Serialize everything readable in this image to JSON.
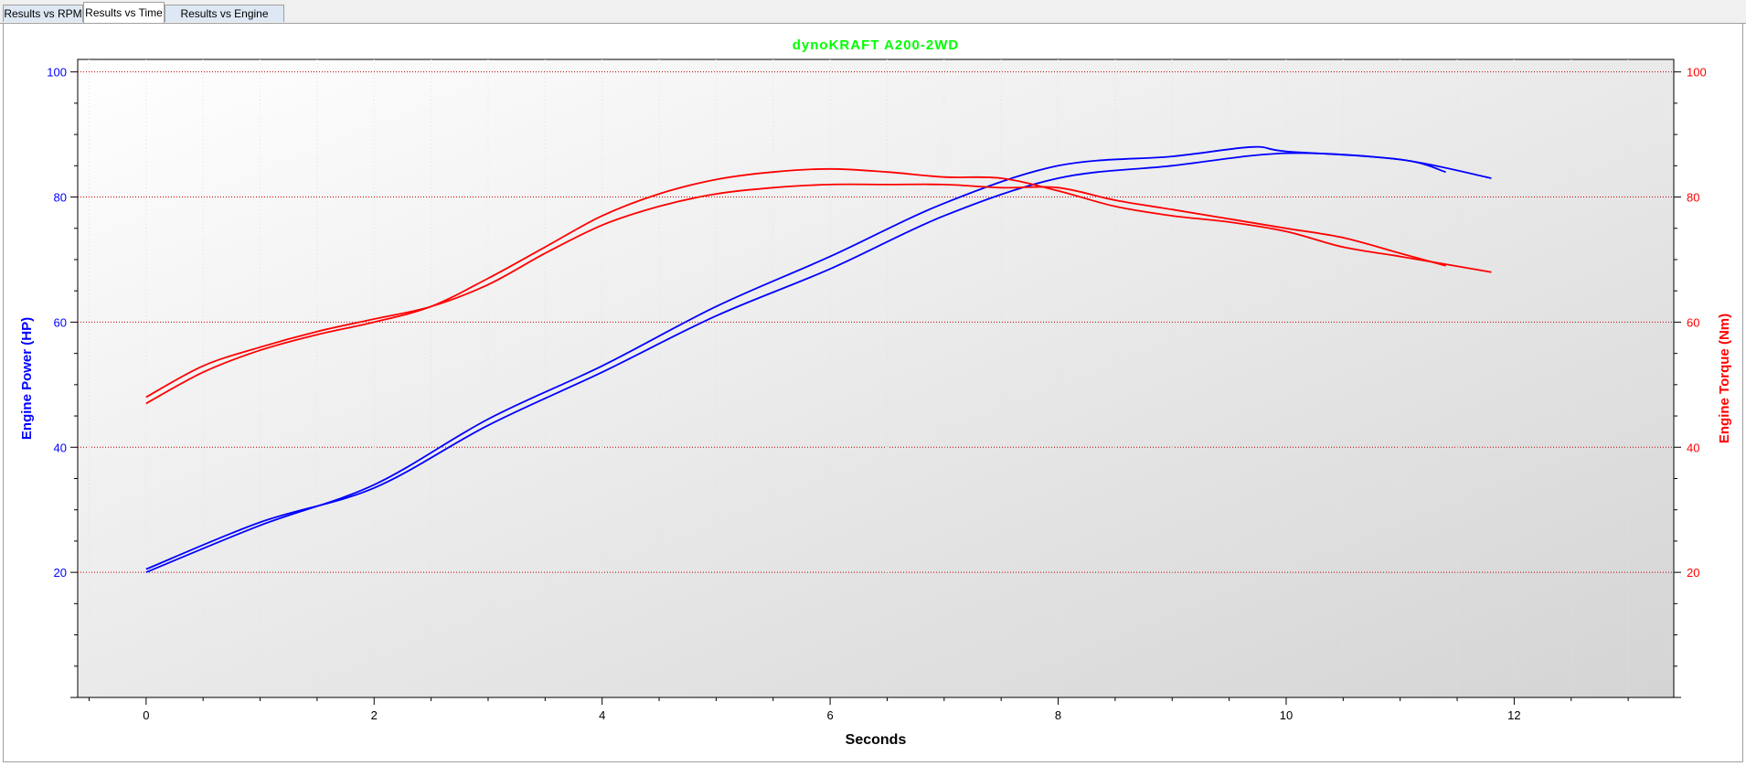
{
  "tabs": [
    {
      "label": "Results vs RPM",
      "active": false
    },
    {
      "label": "Results vs Time",
      "active": true
    },
    {
      "label": "Results vs Engine Torque",
      "active": false
    }
  ],
  "colors": {
    "power": "#0000ff",
    "torque": "#ff0000",
    "title": "#00ff00",
    "grid": "#c00000",
    "plot_bg_start": "#ffffff",
    "plot_bg_end": "#d4d4d4"
  },
  "chart_data": {
    "type": "line",
    "title": "dynoKRAFT A200-2WD",
    "xlabel": "Seconds",
    "ylabel_left": "Engine Power (HP)",
    "ylabel_right": "Engine Torque (Nm)",
    "xlim": [
      -0.6,
      13.4
    ],
    "ylim_left": [
      0,
      102
    ],
    "ylim_right": [
      0,
      102
    ],
    "xticks": [
      0,
      2,
      4,
      6,
      8,
      10,
      12
    ],
    "yticks_left": [
      20,
      40,
      60,
      80,
      100
    ],
    "yticks_right": [
      20,
      40,
      60,
      80,
      100
    ],
    "grid": "horizontal dotted at major y ticks",
    "series": [
      {
        "axis": "left",
        "color": "power",
        "x": [
          0,
          1,
          2,
          3,
          4,
          5,
          6,
          7,
          8,
          9,
          9.7,
          10,
          11,
          11.8
        ],
        "y": [
          20,
          27.5,
          34,
          44.5,
          53,
          62.5,
          70.5,
          79,
          85,
          86.5,
          88,
          87.3,
          86,
          83
        ]
      },
      {
        "axis": "left",
        "color": "power",
        "x": [
          0,
          1,
          2,
          3,
          4,
          5,
          6,
          7,
          8,
          9,
          10,
          11,
          11.4
        ],
        "y": [
          20.5,
          28,
          33.5,
          43.5,
          52,
          61,
          68.5,
          77,
          83,
          85,
          87,
          86,
          84
        ]
      },
      {
        "axis": "right",
        "color": "torque",
        "x": [
          0,
          0.5,
          1,
          1.5,
          2,
          2.5,
          3,
          3.5,
          4,
          4.5,
          5,
          5.5,
          6,
          6.5,
          7,
          7.5,
          8,
          8.5,
          9,
          9.5,
          10,
          10.5,
          11,
          11.8
        ],
        "y": [
          47,
          52,
          55.5,
          58,
          60,
          62.5,
          67,
          72,
          77,
          80.5,
          82.8,
          84,
          84.5,
          84,
          83.2,
          83,
          81,
          78.5,
          77,
          76,
          74.5,
          72,
          70.5,
          68
        ]
      },
      {
        "axis": "right",
        "color": "torque",
        "x": [
          0,
          0.5,
          1,
          1.5,
          2,
          2.5,
          3,
          3.5,
          4,
          4.5,
          5,
          5.5,
          6,
          6.5,
          7,
          7.5,
          8,
          8.5,
          9,
          9.5,
          10,
          10.5,
          11,
          11.4
        ],
        "y": [
          48,
          53,
          56,
          58.5,
          60.5,
          62.5,
          66,
          71,
          75.5,
          78.5,
          80.5,
          81.5,
          82,
          82,
          82,
          81.5,
          81.5,
          79.5,
          78,
          76.5,
          75,
          73.5,
          71,
          69
        ]
      }
    ]
  }
}
